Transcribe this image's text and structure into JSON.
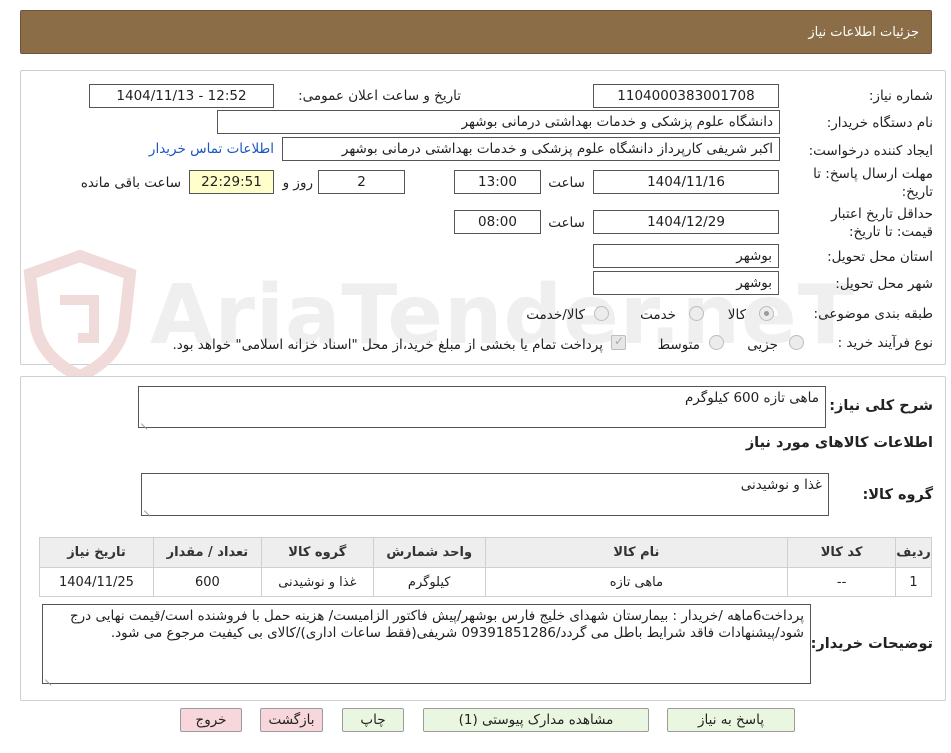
{
  "header": {
    "title": "جزئیات اطلاعات نیاز"
  },
  "watermark": {
    "text": "AriaTender.neT"
  },
  "form": {
    "need_number": {
      "label": "شماره نیاز:",
      "value": "1104000383001708"
    },
    "announce": {
      "label": "تاریخ و ساعت اعلان عمومی:",
      "value": "1404/11/13 - 12:52"
    },
    "buyer": {
      "label": "نام دستگاه خریدار:",
      "value": "دانشگاه علوم پزشکی و خدمات بهداشتی درمانی بوشهر"
    },
    "creator": {
      "label": "ایجاد کننده درخواست:",
      "value": "اکبر شریفی کارپرداز دانشگاه علوم پزشکی و خدمات بهداشتی درمانی بوشهر",
      "contact_link": "اطلاعات تماس خریدار"
    },
    "deadline": {
      "label_line1": "مهلت ارسال پاسخ: تا",
      "label_line2": "تاریخ:",
      "date": "1404/11/16",
      "time_label": "ساعت",
      "time": "13:00",
      "days": "2",
      "days_label": "روز و",
      "remaining": "22:29:51",
      "remaining_label": "ساعت باقی مانده"
    },
    "validity": {
      "label_line1": "حداقل تاریخ اعتبار",
      "label_line2": "قیمت: تا تاریخ:",
      "date": "1404/12/29",
      "time_label": "ساعت",
      "time": "08:00"
    },
    "province": {
      "label": "استان محل تحویل:",
      "value": "بوشهر"
    },
    "city": {
      "label": "شهر محل تحویل:",
      "value": "بوشهر"
    },
    "category": {
      "label": "طبقه بندی موضوعی:",
      "options": [
        "کالا",
        "خدمت",
        "کالا/خدمت"
      ],
      "selected": "کالا"
    },
    "process": {
      "label": "نوع فرآیند خرید :",
      "options": [
        "جزیی",
        "متوسط"
      ],
      "note": "پرداخت تمام یا بخشی از مبلغ خرید،از محل \"اسناد خزانه اسلامی\" خواهد بود."
    }
  },
  "summary": {
    "label": "شرح کلی نیاز:",
    "value": "ماهی تازه 600 کیلوگرم"
  },
  "goods_section": {
    "title": "اطلاعات کالاهای مورد نیاز"
  },
  "goods_group": {
    "label": "گروه کالا:",
    "value": "غذا و نوشیدنی"
  },
  "table": {
    "headers": [
      "ردیف",
      "کد کالا",
      "نام کالا",
      "واحد شمارش",
      "گروه کالا",
      "تعداد / مقدار",
      "تاریخ نیاز"
    ],
    "rows": [
      [
        "1",
        "--",
        "ماهی تازه",
        "کیلوگرم",
        "غذا و نوشیدنی",
        "600",
        "1404/11/25"
      ]
    ]
  },
  "buyer_notes": {
    "label": "توضیحات خریدار:",
    "value": "پرداخت6ماهه /خریدار : بیمارستان شهدای خلیج فارس بوشهر/پیش فاکتور الزامیست/ هزینه حمل با فروشنده است/قیمت نهایی درج شود/پیشنهادات فاقد شرایط باطل می گردد/09391851286 شریفی(فقط ساعات اداری)/کالای بی کیفیت مرجوع می شود."
  },
  "buttons": {
    "reply": "پاسخ به نیاز",
    "attachments": "مشاهده مدارک پیوستی (1)",
    "print": "چاپ",
    "back": "بازگشت",
    "exit": "خروج"
  }
}
